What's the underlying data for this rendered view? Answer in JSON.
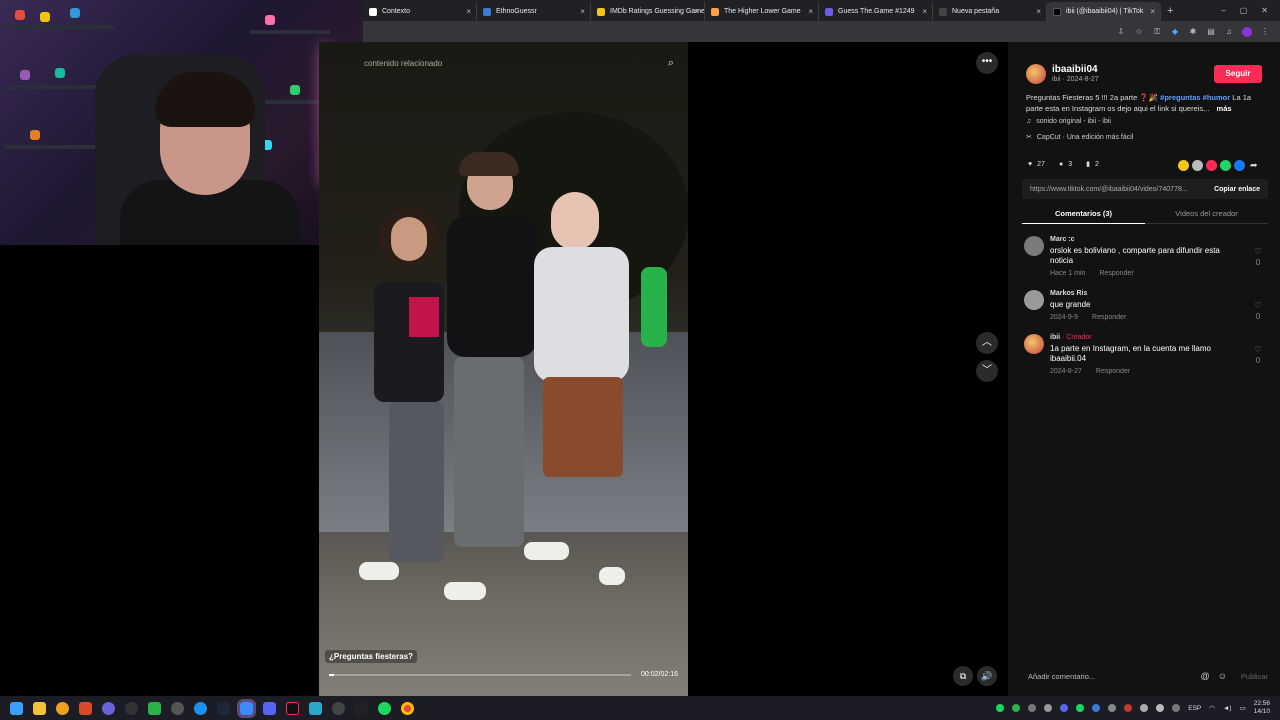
{
  "browser": {
    "tabs": [
      {
        "title": "Contexto",
        "favicon_color": "#ffffff",
        "active": false
      },
      {
        "title": "EthnoGuessr",
        "favicon_color": "#3a7bd5",
        "active": false
      },
      {
        "title": "IMDb Ratings Guessing Game",
        "favicon_color": "#f5c518",
        "active": false
      },
      {
        "title": "The Higher Lower Game",
        "favicon_color": "#ff9f43",
        "active": false
      },
      {
        "title": "Guess The.Game #1249",
        "favicon_color": "#6c5ce7",
        "active": false
      },
      {
        "title": "Nueva pestaña",
        "favicon_color": "#444444",
        "active": false
      },
      {
        "title": "ibii (@ibaaibii04) | TikTok",
        "favicon_color": "#000000",
        "active": true
      }
    ],
    "new_tab_label": "+",
    "close_glyph": "×",
    "window_controls": [
      "–",
      "▢",
      "✕"
    ]
  },
  "player": {
    "search_placeholder": "contenido relacionado",
    "caption": "¿Preguntas fiesteras?",
    "time": "00:02/02:16",
    "progress": 0.015,
    "more_glyph": "•••",
    "up_glyph": "︿",
    "down_glyph": "﹀",
    "mute_glyph": "🔊",
    "float_glyph": "⧉"
  },
  "post": {
    "username": "ibaaibii04",
    "meta": "ibii · 2024-8-27",
    "follow_label": "Seguir",
    "description_text": "Preguntas Fiesteras 5 !!! 2a parte ❓🎉",
    "tags": "#preguntas #humor",
    "description_tail": "La 1a parte esta en Instagram os dejo aqui el link si quereis...",
    "more_label": "más",
    "sound": "sonido original - ibii - ibii",
    "capcut": "CapCut · Una edición más fácil",
    "likes": "27",
    "comments": "3",
    "saves": "2",
    "link": "https://www.tiktok.com/@ibaaibii04/video/740778...",
    "copy_label": "Copiar enlace",
    "tab_comments": "Comentarios (3)",
    "tab_creator": "Videos del creador",
    "share_colors": [
      "#f5c518",
      "#bbbbbb",
      "#fe2c55",
      "#25d366",
      "#1877f2"
    ]
  },
  "comments": [
    {
      "user": "Marc :c",
      "badge": "",
      "text": "orslok es boliviano , comparte para difundir esta noticia",
      "date": "Hace 1 min",
      "reply": "Responder",
      "likes": "0"
    },
    {
      "user": "Markos Ris",
      "badge": "",
      "text": "que grande",
      "date": "2024-9-9",
      "reply": "Responder",
      "likes": "0"
    },
    {
      "user": "ibii",
      "badge": " · Creador",
      "text": "1a parte en Instagram, en la cuenta me llamo ibaaibii.04",
      "date": "2024-8-27",
      "reply": "Responder",
      "likes": "0"
    }
  ],
  "composer": {
    "placeholder": "Añadir comentario...",
    "publish_label": "Publicar"
  },
  "taskbar": {
    "language": "ESP",
    "time": "22:56",
    "date": "14/10"
  }
}
